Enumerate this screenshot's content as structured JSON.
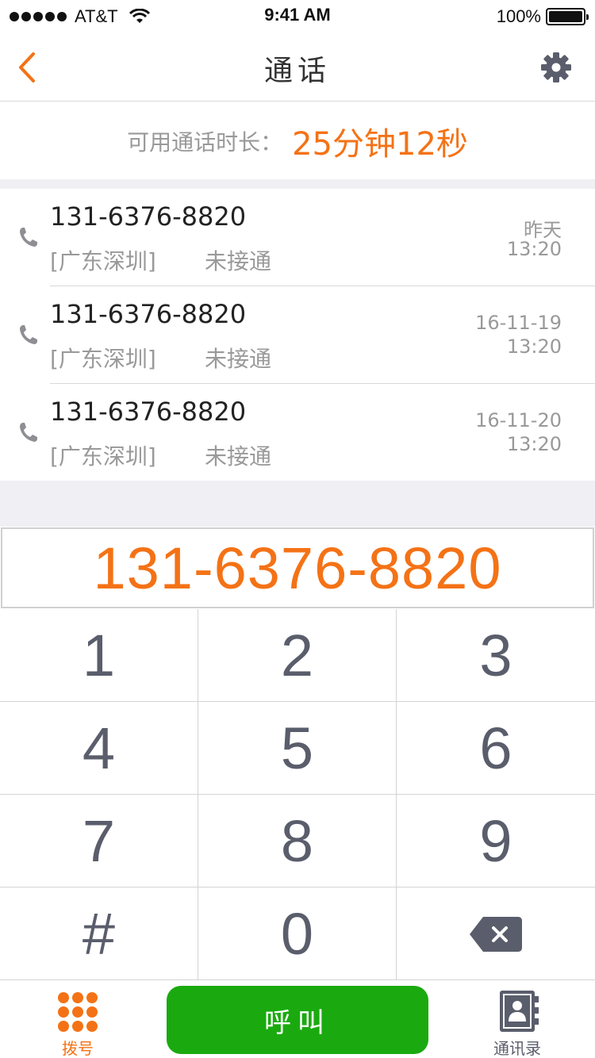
{
  "status_bar": {
    "carrier": "AT&T",
    "time": "9:41 AM",
    "battery": "100%"
  },
  "nav": {
    "title": "通话",
    "back_icon": "chevron-left-icon",
    "settings_icon": "gear-icon"
  },
  "balance": {
    "label": "可用通话时长：",
    "value": "25分钟12秒"
  },
  "call_log": [
    {
      "number": "131-6376-8820",
      "location": "[广东深圳]",
      "status": "未接通",
      "date": "昨天",
      "time": "13:20"
    },
    {
      "number": "131-6376-8820",
      "location": "[广东深圳]",
      "status": "未接通",
      "date": "16-11-19",
      "time": "13:20"
    },
    {
      "number": "131-6376-8820",
      "location": "[广东深圳]",
      "status": "未接通",
      "date": "16-11-20",
      "time": "13:20"
    }
  ],
  "dial_display": {
    "number": "131-6376-8820"
  },
  "keypad": {
    "keys": [
      "1",
      "2",
      "3",
      "4",
      "5",
      "6",
      "7",
      "8",
      "9",
      "#",
      "0"
    ],
    "delete_icon": "backspace-icon"
  },
  "tab_bar": {
    "dial_label": "拨号",
    "call_label": "呼叫",
    "contacts_label": "通讯录"
  },
  "colors": {
    "accent": "#f47216",
    "call_green": "#1aaa0f",
    "key_gray": "#5a5d6b",
    "separator": "#efeff4"
  }
}
